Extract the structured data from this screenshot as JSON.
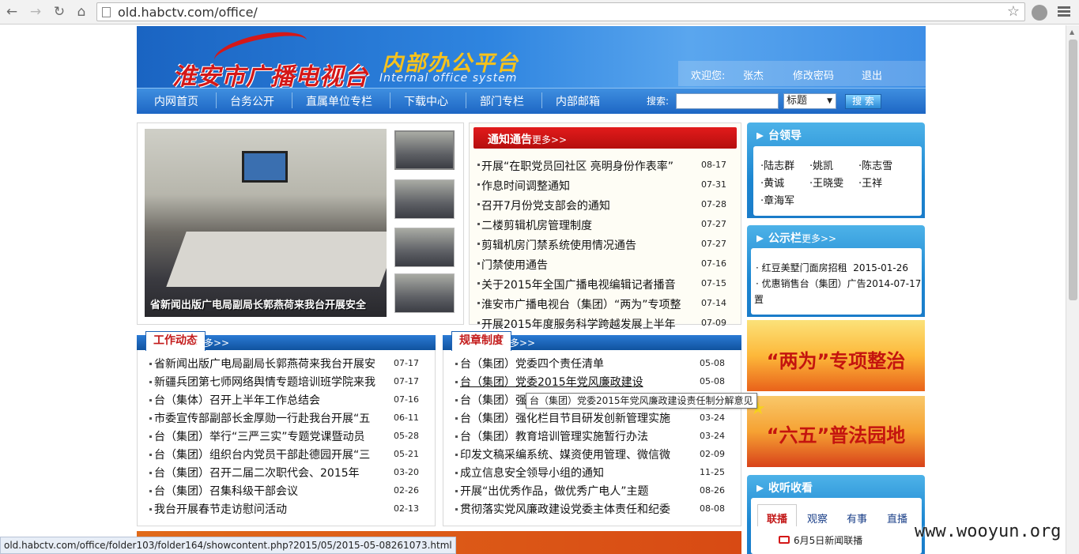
{
  "browser": {
    "url": "old.habctv.com/office/",
    "status_url": "old.habctv.com/office/folder103/folder164/showcontent.php?2015/05/2015-05-08261073.html"
  },
  "header": {
    "logo_text": "淮安市广播电视台",
    "title": "内部办公平台",
    "subtitle": "Internal office system",
    "welcome": "欢迎您:",
    "user": "张杰",
    "change_password": "修改密码",
    "logout": "退出"
  },
  "nav": {
    "items": [
      "内网首页",
      "台务公开",
      "直属单位专栏",
      "下载中心",
      "部门专栏",
      "内部邮箱"
    ],
    "search_label": "搜索:",
    "search_value": "",
    "search_option": "标题",
    "search_button": "搜 索"
  },
  "photo": {
    "caption": "省新闻出版广电局副局长郭燕荷来我台开展安全"
  },
  "notices": {
    "title": "通知通告",
    "more": "更多>>",
    "items": [
      {
        "title": "开展“在职党员回社区 亮明身份作表率”",
        "date": "08-17"
      },
      {
        "title": "作息时间调整通知",
        "date": "07-31"
      },
      {
        "title": "召开7月份党支部会的通知",
        "date": "07-28"
      },
      {
        "title": "二楼剪辑机房管理制度",
        "date": "07-27"
      },
      {
        "title": "剪辑机房门禁系统使用情况通告",
        "date": "07-27"
      },
      {
        "title": "门禁使用通告",
        "date": "07-16"
      },
      {
        "title": "关于2015年全国广播电视编辑记者播音",
        "date": "07-15"
      },
      {
        "title": "淮安市广播电视台（集团）“两为”专项整",
        "date": "07-14"
      },
      {
        "title": "开展2015年度服务科学跨越发展上半年",
        "date": "07-09"
      }
    ]
  },
  "work": {
    "title": "工作动态",
    "more": "更多>>",
    "items": [
      {
        "title": "省新闻出版广电局副局长郭燕荷来我台开展安",
        "date": "07-17"
      },
      {
        "title": "新疆兵团第七师网络舆情专题培训班学院来我",
        "date": "07-17"
      },
      {
        "title": "台（集体）召开上半年工作总结会",
        "date": "07-16"
      },
      {
        "title": "市委宣传部副部长金厚勋一行赴我台开展“五",
        "date": "06-11"
      },
      {
        "title": "台（集团）举行“三严三实”专题党课暨动员",
        "date": "05-28"
      },
      {
        "title": "台（集团）组织台内党员干部赴德园开展“三",
        "date": "05-21"
      },
      {
        "title": "台（集团）召开二届二次职代会、2015年",
        "date": "03-20"
      },
      {
        "title": "台（集团）召集科级干部会议",
        "date": "02-26"
      },
      {
        "title": "我台开展春节走访慰问活动",
        "date": "02-13"
      }
    ]
  },
  "rules": {
    "title": "规章制度",
    "more": "更多>>",
    "items": [
      {
        "title": "台（集团）党委四个责任清单",
        "date": "05-08"
      },
      {
        "title": "台（集团）党委2015年党风廉政建设",
        "date": "05-08"
      },
      {
        "title": "台（集团）强",
        "date": ""
      },
      {
        "title": "台（集团）强化栏目节目研发创新管理实施",
        "date": "03-24"
      },
      {
        "title": "台（集团）教育培训管理实施暂行办法",
        "date": "03-24"
      },
      {
        "title": "印发文稿采编系统、媒资使用管理、微信微",
        "date": "02-09"
      },
      {
        "title": "成立信息安全领导小组的通知",
        "date": "11-25"
      },
      {
        "title": "开展“出优秀作品，做优秀广电人”主题",
        "date": "08-26"
      },
      {
        "title": "贯彻落实党风廉政建设党委主体责任和纪委",
        "date": "08-08"
      }
    ],
    "tooltip": "台（集团）党委2015年党风廉政建设责任制分解意见"
  },
  "leaders": {
    "title": "台领导",
    "names": [
      "陆志群",
      "姚凯",
      "陈志雪",
      "黄诚",
      "王晓雯",
      "王祥",
      "章海军"
    ]
  },
  "bulletin": {
    "title": "公示栏",
    "more": "更多>>",
    "items": [
      {
        "title": "红豆美墅门面房招租",
        "date": "2015-01-26"
      },
      {
        "title": "优惠销售台（集团）广告",
        "date": "2014-07-17",
        "wrap": "置"
      }
    ]
  },
  "ads": {
    "ad1": "“两为”专项整治",
    "ad2": "“六五”普法园地"
  },
  "tv": {
    "title": "收听收看",
    "tabs": [
      "联播",
      "观察",
      "有事",
      "直播"
    ],
    "item": "6月5日新闻联播"
  },
  "watermark": "www.wooyun.org",
  "colors": {
    "accent_blue": "#1d66c4",
    "accent_red": "#c31a1a"
  }
}
